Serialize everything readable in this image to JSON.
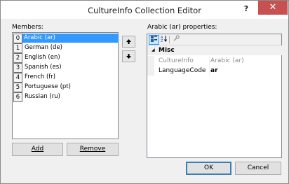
{
  "window": {
    "title": "CultureInfo Collection Editor",
    "help_label": "?",
    "close_label": "✕"
  },
  "members": {
    "label": "Members:",
    "items": [
      {
        "index": "0",
        "label": "Arabic (ar)",
        "selected": true
      },
      {
        "index": "1",
        "label": "German (de)"
      },
      {
        "index": "2",
        "label": "English (en)"
      },
      {
        "index": "3",
        "label": "Spanish (es)"
      },
      {
        "index": "4",
        "label": "French (fr)"
      },
      {
        "index": "5",
        "label": "Portuguese (pt)"
      },
      {
        "index": "6",
        "label": "Russian (ru)"
      }
    ],
    "add_label": "Add",
    "remove_label": "Remove",
    "move_up_icon": "up-arrow-icon",
    "move_down_icon": "down-arrow-icon"
  },
  "properties": {
    "label": "Arabic (ar) properties:",
    "toolbar": [
      "categorized-icon",
      "alphabetical-icon",
      "property-pages-icon"
    ],
    "category": {
      "name": "Misc",
      "toggle": "◢"
    },
    "rows": [
      {
        "name": "CultureInfo",
        "value": "Arabic (ar)",
        "readonly": true
      },
      {
        "name": "LanguageCode",
        "value": "ar",
        "readonly": false
      }
    ]
  },
  "footer": {
    "ok_label": "OK",
    "cancel_label": "Cancel"
  }
}
